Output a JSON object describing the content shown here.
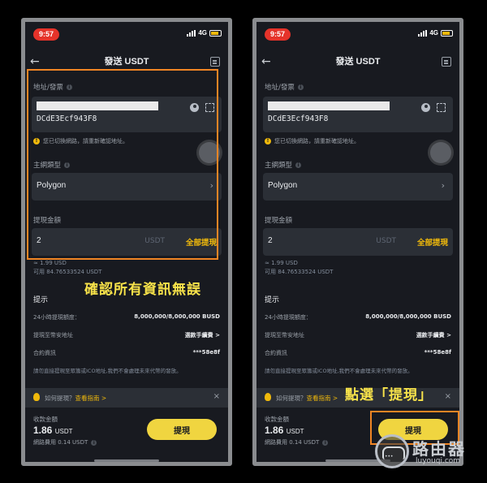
{
  "status": {
    "time": "9:57",
    "network": "4G"
  },
  "nav": {
    "title": "發送 USDT"
  },
  "address": {
    "label": "地址/發票",
    "value": "DCdE3Ecf943F8",
    "warning": "您已切換網路，請重新確認地址。"
  },
  "network": {
    "label": "主網類型",
    "value": "Polygon"
  },
  "amount": {
    "label": "提現金額",
    "value": "2",
    "unit": "USDT",
    "all_label": "全部提現",
    "approx": "≈ 1.99 USD",
    "available": "可用 84.76533524 USDT"
  },
  "tips": {
    "title": "提示",
    "rows": [
      {
        "label": "24小時提現額度：",
        "value": "8,000,000/8,000,000 BUSD"
      },
      {
        "label": "提現至幣安地址",
        "value": "選款手續費 >"
      },
      {
        "label": "合約資訊",
        "value": "***58e8f"
      }
    ],
    "note": "請勿直接提現至眾籌或ICO地址,我們不會處理未來代幣的發放。"
  },
  "guide": {
    "question": "如何提現？",
    "link": "查看指南 >",
    "close": "×"
  },
  "footer": {
    "receive_label": "收款金額",
    "receive_value": "1.86",
    "receive_unit": "USDT",
    "fee": "網路費用 0.14 USDT",
    "withdraw_button": "提現"
  },
  "annotations": {
    "callout_left": "確認所有資訊無誤",
    "callout_right": "點選「提現」"
  },
  "watermark": {
    "cn": "路由器",
    "en": "luyouqi.com"
  },
  "colors": {
    "accent": "#f0b90b",
    "highlight": "#f08524",
    "callout": "#f8e34a",
    "background": "#181a20",
    "field": "#2b2f36"
  }
}
